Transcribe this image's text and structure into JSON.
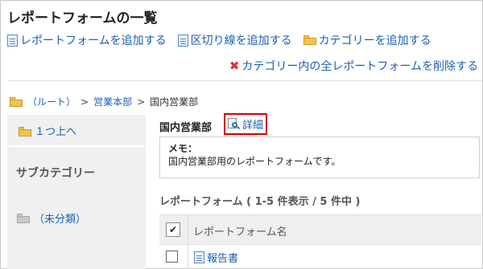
{
  "page": {
    "title": "レポートフォームの一覧"
  },
  "toolbar": {
    "add_form": "レポートフォームを追加する",
    "add_separator": "区切り線を追加する",
    "add_category": "カテゴリーを追加する",
    "delete_all": "カテゴリー内の全レポートフォームを削除する"
  },
  "breadcrumb": {
    "root": "（ルート）",
    "sep": ">",
    "level1": "営業本部",
    "current": "国内営業部"
  },
  "sidebar": {
    "up_label": "１つ上へ",
    "subcategory_heading": "サブカテゴリー",
    "uncategorized": "（未分類）"
  },
  "category": {
    "name": "国内営業部",
    "detail_label": "詳細"
  },
  "memo": {
    "label": "メモ：",
    "text": "国内営業部用のレポートフォームです。"
  },
  "forms": {
    "heading": "レポートフォーム ( 1-5 件表示 / 5 件中 )",
    "column_header": "レポートフォーム名",
    "header_check": "✔",
    "rows": [
      {
        "name": "報告書"
      }
    ]
  },
  "icons": [
    "doc-add-icon",
    "separator-icon",
    "folder-add-icon",
    "delete-icon",
    "folder-icon",
    "magnifier-icon",
    "form-icon"
  ]
}
